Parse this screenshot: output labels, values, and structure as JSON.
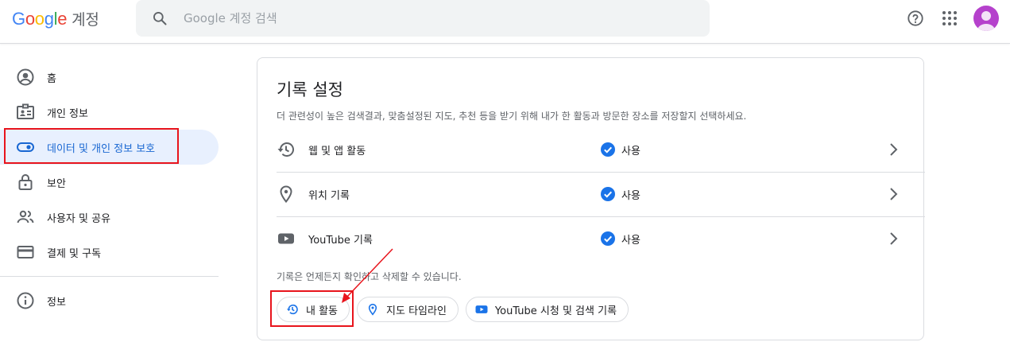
{
  "header": {
    "logo_letters": [
      "G",
      "o",
      "o",
      "g",
      "l",
      "e"
    ],
    "product": "계정",
    "search_placeholder": "Google 계정 검색",
    "help_icon": "help-icon",
    "apps_icon": "apps-grid-icon",
    "avatar_color": "#b541cc"
  },
  "sidebar": {
    "items": [
      {
        "label": "홈",
        "icon": "account-circle-icon"
      },
      {
        "label": "개인 정보",
        "icon": "id-card-icon"
      },
      {
        "label": "데이터 및 개인 정보 보호",
        "icon": "toggle-icon",
        "active": true
      },
      {
        "label": "보안",
        "icon": "lock-icon"
      },
      {
        "label": "사용자 및 공유",
        "icon": "people-icon"
      },
      {
        "label": "결제 및 구독",
        "icon": "credit-card-icon"
      }
    ],
    "footer_items": [
      {
        "label": "정보",
        "icon": "info-icon"
      }
    ]
  },
  "history": {
    "title": "기록 설정",
    "description": "더 관련성이 높은 검색결과, 맞춤설정된 지도, 추천 등을 받기 위해 내가 한 활동과 방문한 장소를 저장할지 선택하세요.",
    "rows": [
      {
        "label": "웹 및 앱 활동",
        "status": "사용",
        "icon": "history-icon"
      },
      {
        "label": "위치 기록",
        "status": "사용",
        "icon": "location-pin-icon"
      },
      {
        "label": "YouTube 기록",
        "status": "사용",
        "icon": "youtube-icon"
      }
    ],
    "note": "기록은 언제든지 확인하고 삭제할 수 있습니다.",
    "chips": [
      {
        "label": "내 활동",
        "icon": "history-icon"
      },
      {
        "label": "지도 타임라인",
        "icon": "location-pin-icon"
      },
      {
        "label": "YouTube 시청 및 검색 기록",
        "icon": "youtube-icon"
      }
    ]
  },
  "colors": {
    "accent": "#1a73e8",
    "active_bg": "#e8f0fe",
    "highlight_red": "#e8141c"
  }
}
